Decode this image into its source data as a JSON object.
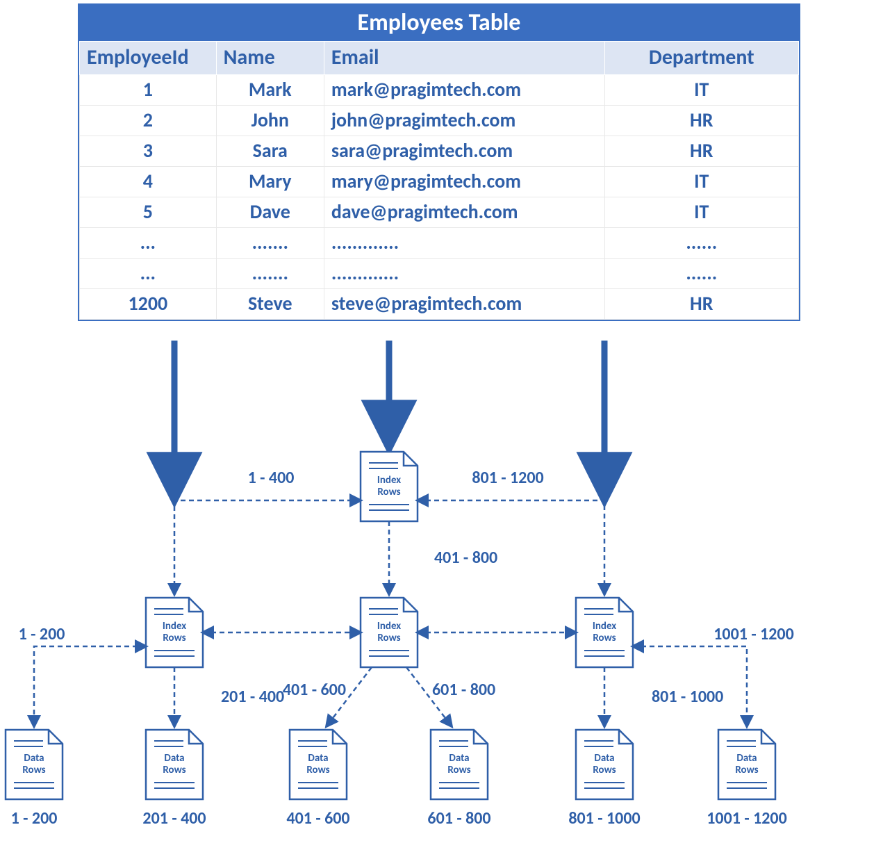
{
  "table": {
    "title": "Employees Table",
    "headers": {
      "id": "EmployeeId",
      "name": "Name",
      "email": "Email",
      "department": "Department"
    },
    "rows": [
      {
        "id": "1",
        "name": "Mark",
        "email": "mark@pragimtech.com",
        "department": "IT"
      },
      {
        "id": "2",
        "name": "John",
        "email": "john@pragimtech.com",
        "department": "HR"
      },
      {
        "id": "3",
        "name": "Sara",
        "email": "sara@pragimtech.com",
        "department": "HR"
      },
      {
        "id": "4",
        "name": "Mary",
        "email": "mary@pragimtech.com",
        "department": "IT"
      },
      {
        "id": "5",
        "name": "Dave",
        "email": "dave@pragimtech.com",
        "department": "IT"
      },
      {
        "id": "...",
        "name": ".......",
        "email": ".............",
        "department": "......"
      },
      {
        "id": "...",
        "name": ".......",
        "email": ".............",
        "department": "......"
      },
      {
        "id": "1200",
        "name": "Steve",
        "email": "steve@pragimtech.com",
        "department": "HR"
      }
    ]
  },
  "tree": {
    "rootRanges": {
      "left": "1 - 400",
      "mid": "401 - 800",
      "right": "801 - 1200"
    },
    "level2Ranges": {
      "l1": "1 - 200",
      "l2": "201 - 400",
      "m1": "401 - 600",
      "m2": "601 - 800",
      "r1": "801 - 1000",
      "r2": "1001 - 1200"
    },
    "leafRanges": {
      "a": "1 - 200",
      "b": "201 - 400",
      "c": "401 - 600",
      "d": "601 - 800",
      "e": "801 - 1000",
      "f": "1001 - 1200"
    },
    "labels": {
      "index": "Index",
      "rows": "Rows",
      "data": "Data"
    }
  }
}
